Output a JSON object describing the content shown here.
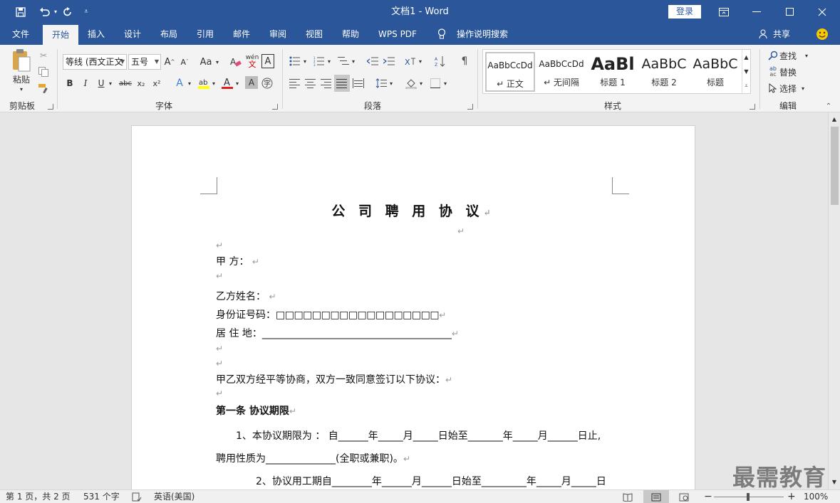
{
  "titlebar": {
    "title": "文档1  -  Word",
    "login": "登录"
  },
  "tabs": [
    "文件",
    "开始",
    "插入",
    "设计",
    "布局",
    "引用",
    "邮件",
    "审阅",
    "视图",
    "帮助",
    "WPS PDF"
  ],
  "tell_me": "操作说明搜索",
  "share": "共享",
  "ribbon": {
    "clipboard": {
      "paste": "粘贴",
      "label": "剪贴板"
    },
    "font": {
      "name": "等线 (西文正文",
      "size": "五号",
      "label": "字体",
      "bold": "B",
      "italic": "I",
      "underline": "U",
      "strike": "abc",
      "sub": "x₂",
      "sup": "x²",
      "aa": "Aa",
      "wen": "wén",
      "A": "A"
    },
    "paragraph": {
      "label": "段落"
    },
    "styles": {
      "label": "样式",
      "items": [
        {
          "sample": "AaBbCcDd",
          "name": "↵ 正文"
        },
        {
          "sample": "AaBbCcDd",
          "name": "↵ 无间隔"
        },
        {
          "sample": "AaBl",
          "name": "标题 1"
        },
        {
          "sample": "AaBbC",
          "name": "标题 2"
        },
        {
          "sample": "AaBbC",
          "name": "标题"
        }
      ]
    },
    "editing": {
      "find": "查找",
      "replace": "替换",
      "select": "选择",
      "label": "编辑"
    }
  },
  "document": {
    "title": "公 司 聘 用 协 议",
    "party_a": "甲      方：",
    "party_b_name": "乙方姓名：",
    "id_label": "身份证号码：",
    "id_boxes": "□□□□□□□□□□□□□□□□□□",
    "address": "居    住    地：",
    "address_line": "______________________________________",
    "agreement": "甲乙双方经平等协商，双方一致同意签订以下协议：",
    "article1": "第一条  协议期限",
    "clause1": "1、本协议期限为  ：  自______年_____月_____日始至_______年_____月______日止,",
    "clause1b": "聘用性质为______________(全职或兼职)。",
    "clause2": "2、协议用工期自________年______月______日始至_________年_____月_____日",
    "pm": "↵"
  },
  "status": {
    "page": "第 1 页，共 2 页",
    "words": "531 个字",
    "lang": "英语(美国)",
    "zoom": "100%"
  },
  "watermark": "最需教育"
}
